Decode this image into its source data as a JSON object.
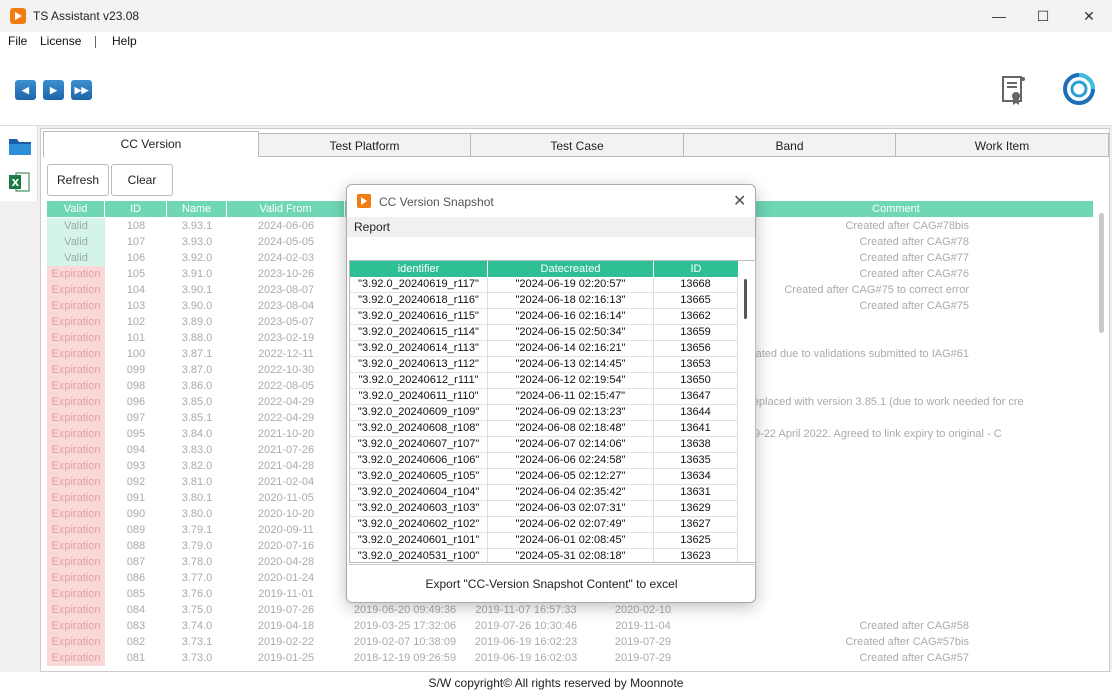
{
  "window": {
    "title": "TS Assistant v23.08",
    "minimize": "—",
    "maximize": "☐",
    "close": "✕"
  },
  "menu": [
    "File",
    "License",
    "Help"
  ],
  "toolbar": {
    "nav": [
      "◀",
      "▶",
      "▶▶"
    ]
  },
  "tabs": [
    "CC Version",
    "Test Platform",
    "Test Case",
    "Band",
    "Work Item"
  ],
  "buttons": {
    "refresh": "Refresh",
    "clear": "Clear"
  },
  "grid": {
    "columns": [
      "Valid",
      "ID",
      "Name",
      "Valid From",
      "Comment"
    ],
    "rows": [
      [
        "Valid",
        "108",
        "3.93.1",
        "2024-06-06",
        "",
        "",
        "",
        "Created after CAG#78bis"
      ],
      [
        "Valid",
        "107",
        "3.93.0",
        "2024-05-05",
        "",
        "",
        "",
        "Created after CAG#78"
      ],
      [
        "Valid",
        "106",
        "3.92.0",
        "2024-02-03",
        "",
        "",
        "",
        "Created after CAG#77"
      ],
      [
        "Expiration",
        "105",
        "3.91.0",
        "2023-10-26",
        "",
        "",
        "",
        "Created after CAG#76"
      ],
      [
        "Expiration",
        "104",
        "3.90.1",
        "2023-08-07",
        "",
        "",
        "",
        "Created after CAG#75 to correct error"
      ],
      [
        "Expiration",
        "103",
        "3.90.0",
        "2023-08-04",
        "",
        "",
        "",
        "Created after CAG#75"
      ],
      [
        "Expiration",
        "102",
        "3.89.0",
        "2023-05-07",
        "",
        "",
        "",
        ""
      ],
      [
        "Expiration",
        "101",
        "3.88.0",
        "2023-02-19",
        "",
        "",
        "",
        ""
      ],
      [
        "Expiration",
        "100",
        "3.87.1",
        "2022-12-11",
        "",
        "",
        "",
        "Created due to validations submitted to IAG#61"
      ],
      [
        "Expiration",
        "099",
        "3.87.0",
        "2022-10-30",
        "",
        "",
        "",
        ""
      ],
      [
        "Expiration",
        "098",
        "3.86.0",
        "2022-08-05",
        "",
        "",
        "",
        ""
      ],
      [
        "Expiration",
        "096",
        "3.85.0",
        "2022-04-29",
        "",
        "",
        "",
        "mediately replaced with version 3.85.1 (due to work needed for cre"
      ],
      [
        "Expiration",
        "097",
        "3.85.1",
        "2022-04-29",
        "",
        "",
        "",
        ""
      ],
      [
        "Expiration",
        "095",
        "3.84.0",
        "2021-10-20",
        "",
        "",
        "",
        "0 reset to 19-22 April 2022. Agreed to link expiry to original - C"
      ],
      [
        "Expiration",
        "094",
        "3.83.0",
        "2021-07-26",
        "",
        "",
        "",
        ""
      ],
      [
        "Expiration",
        "093",
        "3.82.0",
        "2021-04-28",
        "",
        "",
        "",
        ""
      ],
      [
        "Expiration",
        "092",
        "3.81.0",
        "2021-02-04",
        "",
        "",
        "",
        ""
      ],
      [
        "Expiration",
        "091",
        "3.80.1",
        "2020-11-05",
        "",
        "",
        "",
        ""
      ],
      [
        "Expiration",
        "090",
        "3.80.0",
        "2020-10-20",
        "",
        "",
        "",
        ""
      ],
      [
        "Expiration",
        "089",
        "3.79.1",
        "2020-09-11",
        "",
        "",
        "",
        ""
      ],
      [
        "Expiration",
        "088",
        "3.79.0",
        "2020-07-16",
        "",
        "",
        "",
        ""
      ],
      [
        "Expiration",
        "087",
        "3.78.0",
        "2020-04-28",
        "",
        "",
        "",
        ""
      ],
      [
        "Expiration",
        "086",
        "3.77.0",
        "2020-01-24",
        "",
        "",
        "",
        ""
      ],
      [
        "Expiration",
        "085",
        "3.76.0",
        "2019-11-01",
        "",
        "",
        "",
        ""
      ],
      [
        "Expiration",
        "084",
        "3.75.0",
        "2019-07-26",
        "2019-06-20 09:49:36",
        "2019-11-07 16:57:33",
        "2020-02-10",
        ""
      ],
      [
        "Expiration",
        "083",
        "3.74.0",
        "2019-04-18",
        "2019-03-25 17:32:06",
        "2019-07-26 10:30:46",
        "2019-11-04",
        "Created after CAG#58"
      ],
      [
        "Expiration",
        "082",
        "3.73.1",
        "2019-02-22",
        "2019-02-07 10:38:09",
        "2019-06-19 16:02:23",
        "2019-07-29",
        "Created after CAG#57bis"
      ],
      [
        "Expiration",
        "081",
        "3.73.0",
        "2019-01-25",
        "2018-12-19 09:26:59",
        "2019-06-19 16:02:03",
        "2019-07-29",
        "Created after CAG#57"
      ]
    ]
  },
  "footer": "S/W copyright© All rights reserved by Moonnote",
  "modal": {
    "title": "CC Version Snapshot",
    "close": "✕",
    "menu": "Report",
    "columns": [
      "identifier",
      "Datecreated",
      "ID"
    ],
    "rows": [
      [
        "\"3.92.0_20240619_r117\"",
        "\"2024-06-19 02:20:57\"",
        "13668"
      ],
      [
        "\"3.92.0_20240618_r116\"",
        "\"2024-06-18 02:16:13\"",
        "13665"
      ],
      [
        "\"3.92.0_20240616_r115\"",
        "\"2024-06-16 02:16:14\"",
        "13662"
      ],
      [
        "\"3.92.0_20240615_r114\"",
        "\"2024-06-15 02:50:34\"",
        "13659"
      ],
      [
        "\"3.92.0_20240614_r113\"",
        "\"2024-06-14 02:16:21\"",
        "13656"
      ],
      [
        "\"3.92.0_20240613_r112\"",
        "\"2024-06-13 02:14:45\"",
        "13653"
      ],
      [
        "\"3.92.0_20240612_r111\"",
        "\"2024-06-12 02:19:54\"",
        "13650"
      ],
      [
        "\"3.92.0_20240611_r110\"",
        "\"2024-06-11 02:15:47\"",
        "13647"
      ],
      [
        "\"3.92.0_20240609_r109\"",
        "\"2024-06-09 02:13:23\"",
        "13644"
      ],
      [
        "\"3.92.0_20240608_r108\"",
        "\"2024-06-08 02:18:48\"",
        "13641"
      ],
      [
        "\"3.92.0_20240607_r107\"",
        "\"2024-06-07 02:14:06\"",
        "13638"
      ],
      [
        "\"3.92.0_20240606_r106\"",
        "\"2024-06-06 02:24:58\"",
        "13635"
      ],
      [
        "\"3.92.0_20240605_r105\"",
        "\"2024-06-05 02:12:27\"",
        "13634"
      ],
      [
        "\"3.92.0_20240604_r104\"",
        "\"2024-06-04 02:35:42\"",
        "13631"
      ],
      [
        "\"3.92.0_20240603_r103\"",
        "\"2024-06-03 02:07:31\"",
        "13629"
      ],
      [
        "\"3.92.0_20240602_r102\"",
        "\"2024-06-02 02:07:49\"",
        "13627"
      ],
      [
        "\"3.92.0_20240601_r101\"",
        "\"2024-06-01 02:08:45\"",
        "13625"
      ],
      [
        "\"3.92.0_20240531_r100\"",
        "\"2024-05-31 02:08:18\"",
        "13623"
      ]
    ],
    "export_label": "Export \"CC-Version Snapshot Content\" to excel"
  }
}
